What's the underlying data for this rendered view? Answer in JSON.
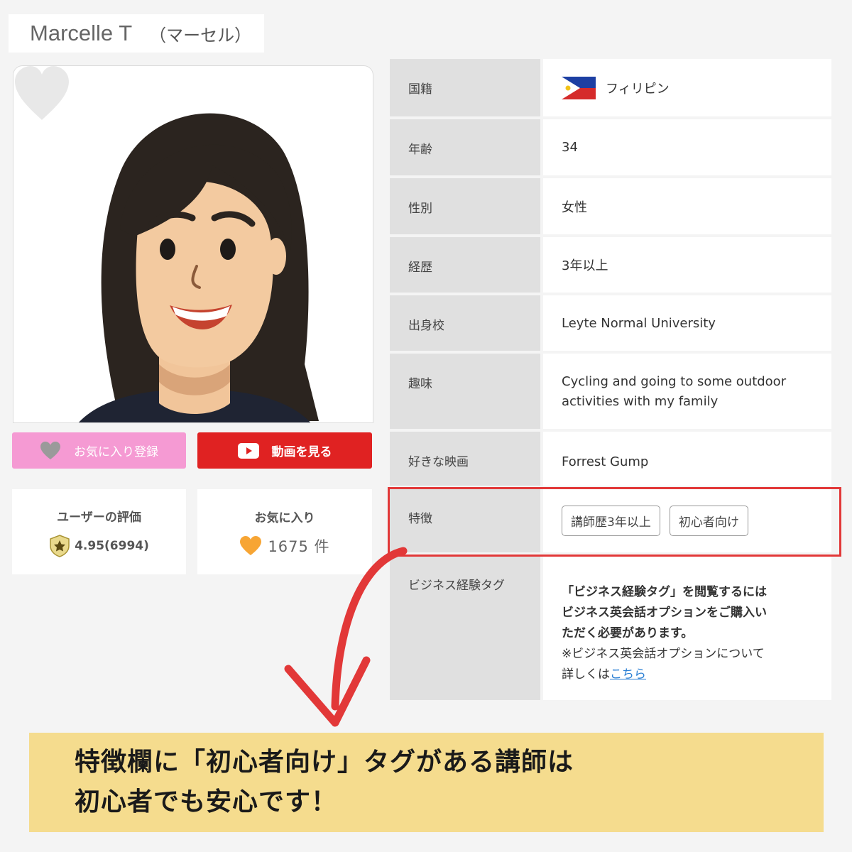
{
  "profile": {
    "name": "Marcelle T",
    "kana": "（マーセル）"
  },
  "buttons": {
    "favorite_label": "お気に入り登録",
    "video_label": "動画を見る"
  },
  "stats": {
    "rating_label": "ユーザーの評価",
    "rating_value": "4.95(6994)",
    "favorites_label": "お気に入り",
    "favorites_count": "1675 件"
  },
  "info": {
    "nationality_label": "国籍",
    "nationality_value": "フィリピン",
    "age_label": "年齢",
    "age_value": "34",
    "gender_label": "性別",
    "gender_value": "女性",
    "career_label": "経歴",
    "career_value": "3年以上",
    "school_label": "出身校",
    "school_value": "Leyte Normal University",
    "hobby_label": "趣味",
    "hobby_value_line1": "Cycling and going to some outdoor",
    "hobby_value_line2": "activities with my family",
    "movie_label": "好きな映画",
    "movie_value": "Forrest Gump",
    "features_label": "特徴",
    "feature_tags": [
      "講師歴3年以上",
      "初心者向け"
    ],
    "business_label": "ビジネス経験タグ",
    "business_line1": "「ビジネス経験タグ」を閲覧するには",
    "business_line2": "ビジネス英会話オプションをご購入い",
    "business_line3": "ただく必要があります。",
    "business_line4": "※ビジネス英会話オプションについて",
    "business_line5_prefix": "詳しくは",
    "business_link": "こちら"
  },
  "banner": {
    "line1": "特徴欄に「初心者向け」タグがある講師は",
    "line2": "初心者でも安心です！"
  },
  "colors": {
    "favorite_button": "#f59ad3",
    "video_button": "#e02222",
    "highlight_border": "#e23838",
    "banner_bg": "#f5dc8e",
    "link": "#2a7fd4"
  },
  "icons": {
    "favorite": "heart-icon",
    "video": "play-icon",
    "rating": "star-badge-icon",
    "favorites_count": "orange-heart-icon",
    "flag": "philippines-flag-icon"
  }
}
